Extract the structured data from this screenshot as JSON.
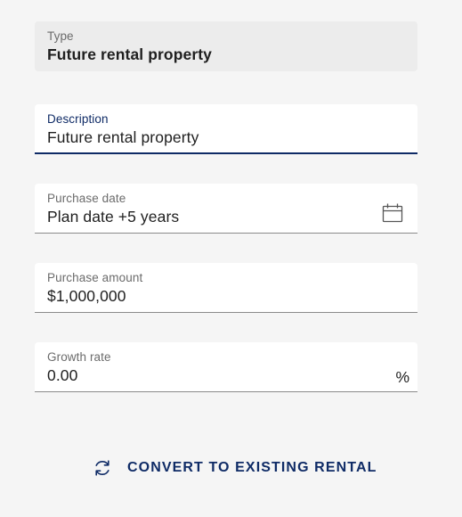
{
  "fields": {
    "type": {
      "label": "Type",
      "value": "Future rental property"
    },
    "description": {
      "label": "Description",
      "value": "Future rental property"
    },
    "purchase_date": {
      "label": "Purchase date",
      "value": "Plan date +5 years"
    },
    "purchase_amount": {
      "label": "Purchase amount",
      "value": "$1,000,000"
    },
    "growth_rate": {
      "label": "Growth rate",
      "value": "0.00",
      "suffix": "%"
    }
  },
  "actions": {
    "convert_label": "CONVERT TO EXISTING RENTAL"
  },
  "icons": {
    "date": "calendar-icon",
    "convert": "sync-icon"
  },
  "colors": {
    "accent": "#0f2b66",
    "background": "#f5f5f5",
    "readonly_field": "#ececec"
  }
}
